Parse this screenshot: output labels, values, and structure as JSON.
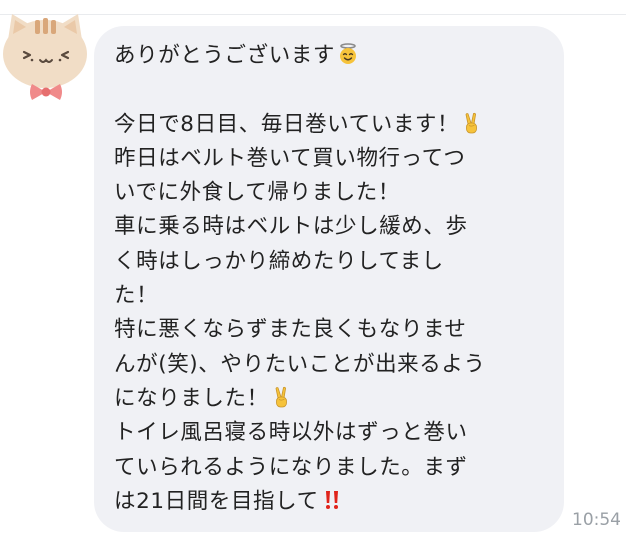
{
  "message": {
    "lines": [
      "ありがとうございます",
      "",
      "今日で8日目、毎日巻いています！",
      "昨日はベルト巻いて買い物行ってつ",
      "いでに外食して帰りました！",
      "車に乗る時はベルトは少し緩め、歩",
      "く時はしっかり締めたりしてまし",
      "た！",
      "特に悪くならずまた良くもなりませ",
      "んが(笑)、やりたいことが出来るよう",
      "になりました！",
      "トイレ風呂寝る時以外はずっと巻い",
      "ていられるようになりました。まず",
      "は21日間を目指して"
    ],
    "emojis": {
      "line0": "smiling-face-with-halo-icon",
      "line2": "victory-hand-icon",
      "line10": "victory-hand-icon",
      "line13": "double-exclamation-icon"
    },
    "timestamp": "10:54"
  },
  "avatar": {
    "icon": "cat-avatar-icon"
  }
}
